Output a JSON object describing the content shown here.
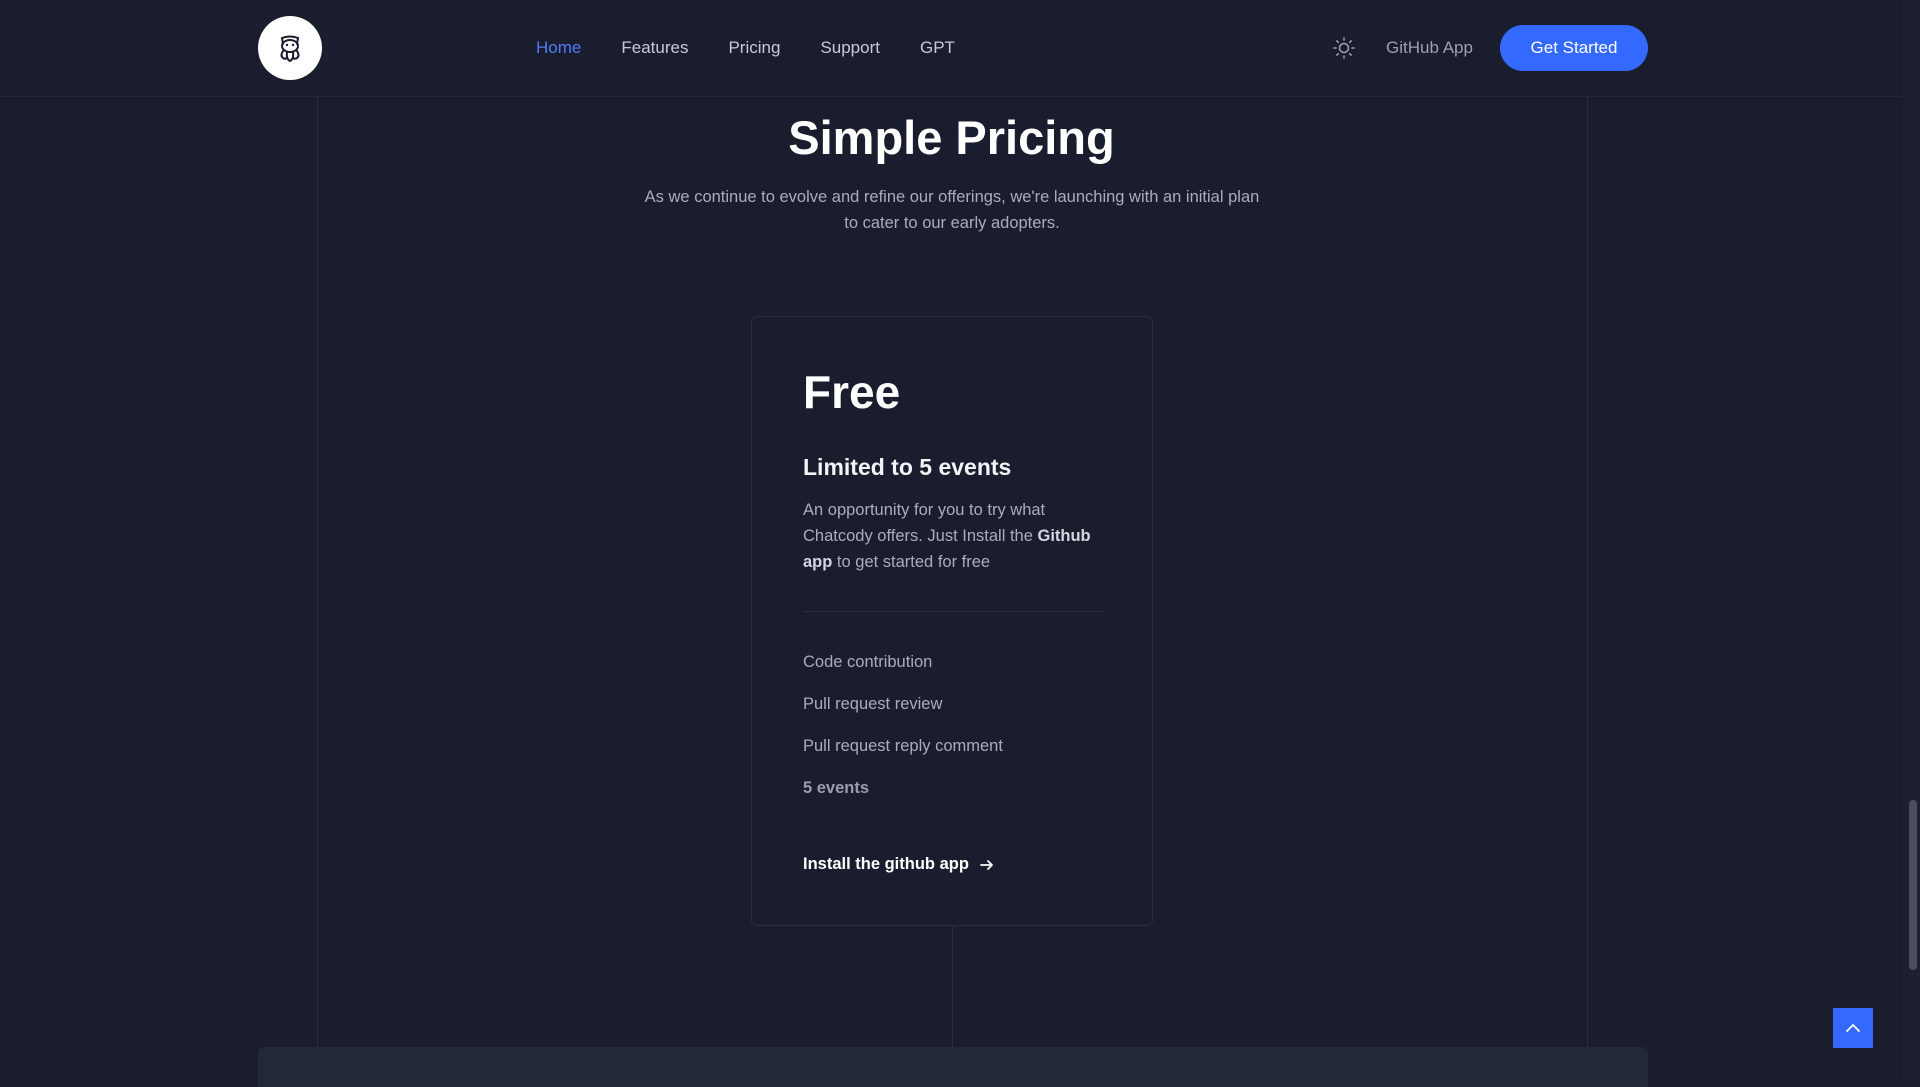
{
  "nav": {
    "brand_logo": "octopus-cat-logo",
    "links": [
      {
        "label": "Home",
        "active": true
      },
      {
        "label": "Features",
        "active": false
      },
      {
        "label": "Pricing",
        "active": false
      },
      {
        "label": "Support",
        "active": false
      },
      {
        "label": "GPT",
        "active": false
      }
    ],
    "theme_icon": "sun-icon",
    "github_app_label": "GitHub App",
    "cta_label": "Get Started",
    "accent_color": "#3369ff"
  },
  "pricing": {
    "title": "Simple Pricing",
    "subtitle": "As we continue to evolve and refine our offerings, we're launching with an initial plan to cater to our early adopters.",
    "plan": {
      "name": "Free",
      "limit": "Limited to 5 events",
      "description_pre": "An opportunity for you to try what Chatcody offers. Just Install the ",
      "description_bold": "Github app",
      "description_post": " to get started for free",
      "features": [
        "Code contribution",
        "Pull request review",
        "Pull request reply comment"
      ],
      "events_feature": "5 events",
      "install_label": "Install the github app",
      "install_icon": "arrow-right-icon"
    }
  },
  "back_to_top_icon": "chevron-up-icon"
}
